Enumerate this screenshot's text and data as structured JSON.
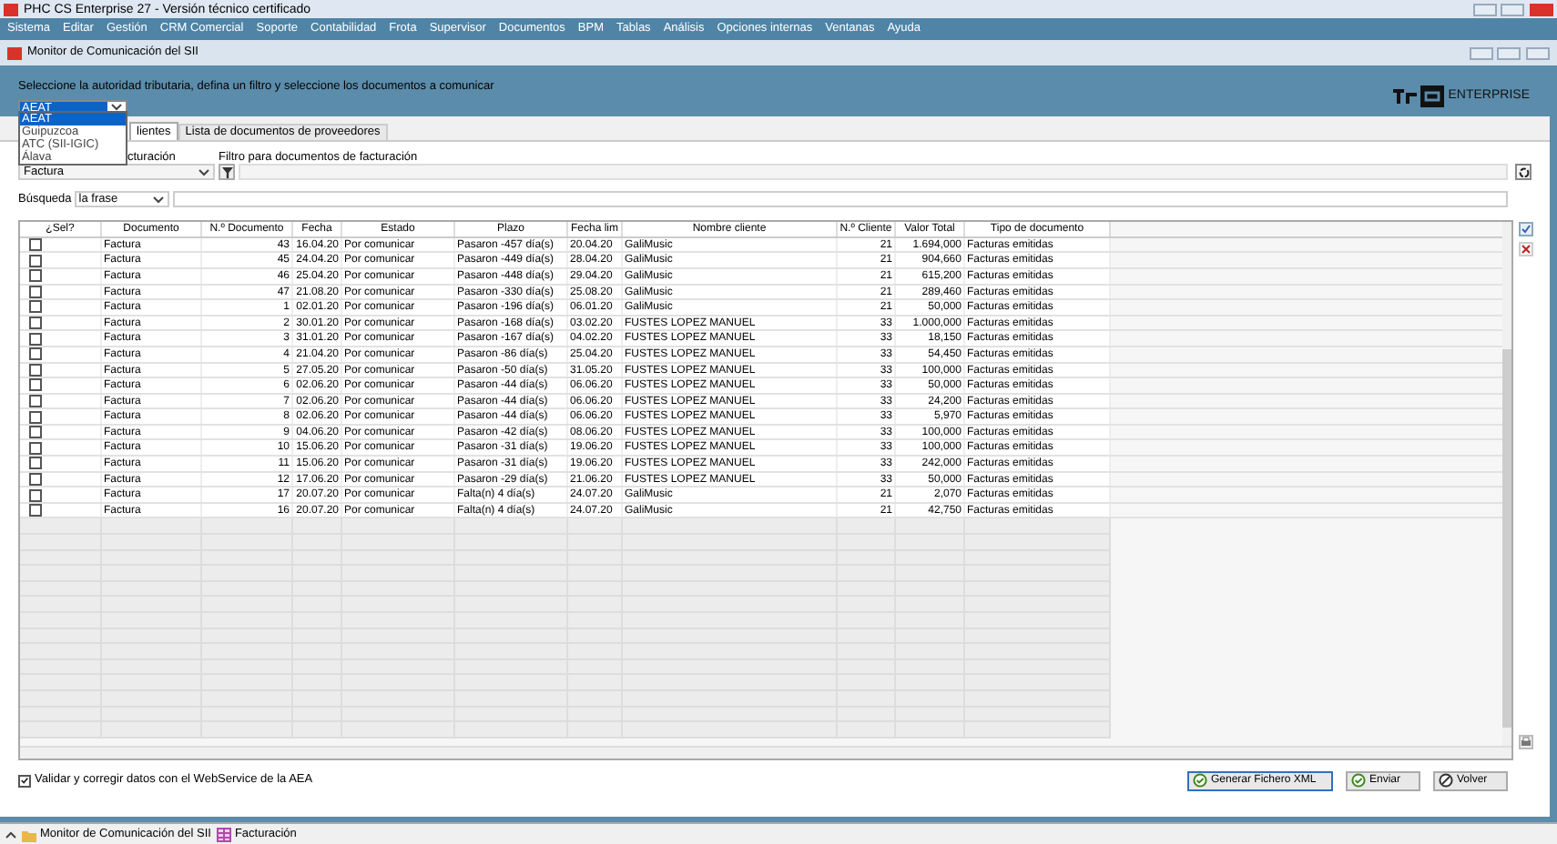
{
  "window": {
    "title": "PHC CS Enterprise 27 - Versión técnico certificado"
  },
  "menu": [
    "Sistema",
    "Editar",
    "Gestión",
    "CRM Comercial",
    "Soporte",
    "Contabilidad",
    "Frota",
    "Supervisor",
    "Documentos",
    "BPM",
    "Tablas",
    "Análisis",
    "Opciones internas",
    "Ventanas",
    "Ayuda"
  ],
  "child_window": {
    "title": "Monitor de Comunicación del SII"
  },
  "header": {
    "instruction": "Seleccione la autoridad tributaria, defina un filtro y seleccione los documentos a comunicar",
    "authority_value": "AEAT",
    "logo_text": "ENTERPRISE",
    "authority_options": [
      {
        "label": "AEAT",
        "selected": true
      },
      {
        "label": "Guipuzcoa",
        "selected": false
      },
      {
        "label": "ATC (SII-IGIC)",
        "selected": false
      },
      {
        "label": "Álava",
        "selected": false
      }
    ]
  },
  "tabs": [
    {
      "label": "lientes",
      "selected": true
    },
    {
      "label": "Lista de documentos de proveedores",
      "selected": false
    }
  ],
  "filters": {
    "doc_type_label": "cturación",
    "doc_type_value": "Factura",
    "filter_label": "Filtro para documentos de facturación",
    "search_label": "Búsqueda",
    "search_mode": "la frase"
  },
  "table": {
    "select_header": "¿Sel?",
    "columns": [
      "Documento",
      "N.º Documento",
      "Fecha",
      "Estado",
      "Plazo",
      "Fecha lim",
      "Nombre cliente",
      "N.º Cliente",
      "Valor Total",
      "Tipo de documento"
    ],
    "rows": [
      {
        "checked": false,
        "cells": [
          "Factura",
          "43",
          "16.04.20",
          "Por comunicar",
          "Pasaron -457 día(s)",
          "20.04.20",
          "GaliMusic",
          "21",
          "1.694,000",
          "Facturas emitidas"
        ]
      },
      {
        "checked": false,
        "cells": [
          "Factura",
          "45",
          "24.04.20",
          "Por comunicar",
          "Pasaron -449 día(s)",
          "28.04.20",
          "GaliMusic",
          "21",
          "904,660",
          "Facturas emitidas"
        ]
      },
      {
        "checked": false,
        "cells": [
          "Factura",
          "46",
          "25.04.20",
          "Por comunicar",
          "Pasaron -448 día(s)",
          "29.04.20",
          "GaliMusic",
          "21",
          "615,200",
          "Facturas emitidas"
        ]
      },
      {
        "checked": false,
        "cells": [
          "Factura",
          "47",
          "21.08.20",
          "Por comunicar",
          "Pasaron -330 día(s)",
          "25.08.20",
          "GaliMusic",
          "21",
          "289,460",
          "Facturas emitidas"
        ]
      },
      {
        "checked": false,
        "cells": [
          "Factura",
          "1",
          "02.01.20",
          "Por comunicar",
          "Pasaron -196 día(s)",
          "06.01.20",
          "GaliMusic",
          "21",
          "50,000",
          "Facturas emitidas"
        ]
      },
      {
        "checked": false,
        "cells": [
          "Factura",
          "2",
          "30.01.20",
          "Por comunicar",
          "Pasaron -168 día(s)",
          "03.02.20",
          "FUSTES LOPEZ MANUEL",
          "33",
          "1.000,000",
          "Facturas emitidas"
        ]
      },
      {
        "checked": false,
        "cells": [
          "Factura",
          "3",
          "31.01.20",
          "Por comunicar",
          "Pasaron -167 día(s)",
          "04.02.20",
          "FUSTES LOPEZ MANUEL",
          "33",
          "18,150",
          "Facturas emitidas"
        ]
      },
      {
        "checked": false,
        "cells": [
          "Factura",
          "4",
          "21.04.20",
          "Por comunicar",
          "Pasaron -86 día(s)",
          "25.04.20",
          "FUSTES LOPEZ MANUEL",
          "33",
          "54,450",
          "Facturas emitidas"
        ]
      },
      {
        "checked": false,
        "cells": [
          "Factura",
          "5",
          "27.05.20",
          "Por comunicar",
          "Pasaron -50 día(s)",
          "31.05.20",
          "FUSTES LOPEZ MANUEL",
          "33",
          "100,000",
          "Facturas emitidas"
        ]
      },
      {
        "checked": false,
        "cells": [
          "Factura",
          "6",
          "02.06.20",
          "Por comunicar",
          "Pasaron -44 día(s)",
          "06.06.20",
          "FUSTES LOPEZ MANUEL",
          "33",
          "50,000",
          "Facturas emitidas"
        ]
      },
      {
        "checked": false,
        "cells": [
          "Factura",
          "7",
          "02.06.20",
          "Por comunicar",
          "Pasaron -44 día(s)",
          "06.06.20",
          "FUSTES LOPEZ MANUEL",
          "33",
          "24,200",
          "Facturas emitidas"
        ]
      },
      {
        "checked": false,
        "cells": [
          "Factura",
          "8",
          "02.06.20",
          "Por comunicar",
          "Pasaron -44 día(s)",
          "06.06.20",
          "FUSTES LOPEZ MANUEL",
          "33",
          "5,970",
          "Facturas emitidas"
        ]
      },
      {
        "checked": false,
        "cells": [
          "Factura",
          "9",
          "04.06.20",
          "Por comunicar",
          "Pasaron -42 día(s)",
          "08.06.20",
          "FUSTES LOPEZ MANUEL",
          "33",
          "100,000",
          "Facturas emitidas"
        ]
      },
      {
        "checked": false,
        "cells": [
          "Factura",
          "10",
          "15.06.20",
          "Por comunicar",
          "Pasaron -31 día(s)",
          "19.06.20",
          "FUSTES LOPEZ MANUEL",
          "33",
          "100,000",
          "Facturas emitidas"
        ]
      },
      {
        "checked": false,
        "cells": [
          "Factura",
          "11",
          "15.06.20",
          "Por comunicar",
          "Pasaron -31 día(s)",
          "19.06.20",
          "FUSTES LOPEZ MANUEL",
          "33",
          "242,000",
          "Facturas emitidas"
        ]
      },
      {
        "checked": false,
        "cells": [
          "Factura",
          "12",
          "17.06.20",
          "Por comunicar",
          "Pasaron -29 día(s)",
          "21.06.20",
          "FUSTES LOPEZ MANUEL",
          "33",
          "50,000",
          "Facturas emitidas"
        ]
      },
      {
        "checked": false,
        "cells": [
          "Factura",
          "17",
          "20.07.20",
          "Por comunicar",
          "Falta(n) 4 día(s)",
          "24.07.20",
          "GaliMusic",
          "21",
          "2,070",
          "Facturas emitidas"
        ]
      },
      {
        "checked": false,
        "cells": [
          "Factura",
          "16",
          "20.07.20",
          "Por comunicar",
          "Falta(n) 4 día(s)",
          "24.07.20",
          "GaliMusic",
          "21",
          "42,750",
          "Facturas emitidas"
        ]
      }
    ]
  },
  "validate": {
    "label": "Validar y corregir datos con el WebService de la AEA",
    "checked": true
  },
  "buttons": [
    {
      "label": "Generar Fichero XML",
      "kind": "ok"
    },
    {
      "label": "Enviar",
      "kind": "ok"
    },
    {
      "label": "Volver",
      "kind": "cancel"
    }
  ],
  "taskbar": [
    {
      "label": "Monitor de Comunicación del SII",
      "kind": "folder"
    },
    {
      "label": "Facturación",
      "kind": "grid"
    }
  ]
}
